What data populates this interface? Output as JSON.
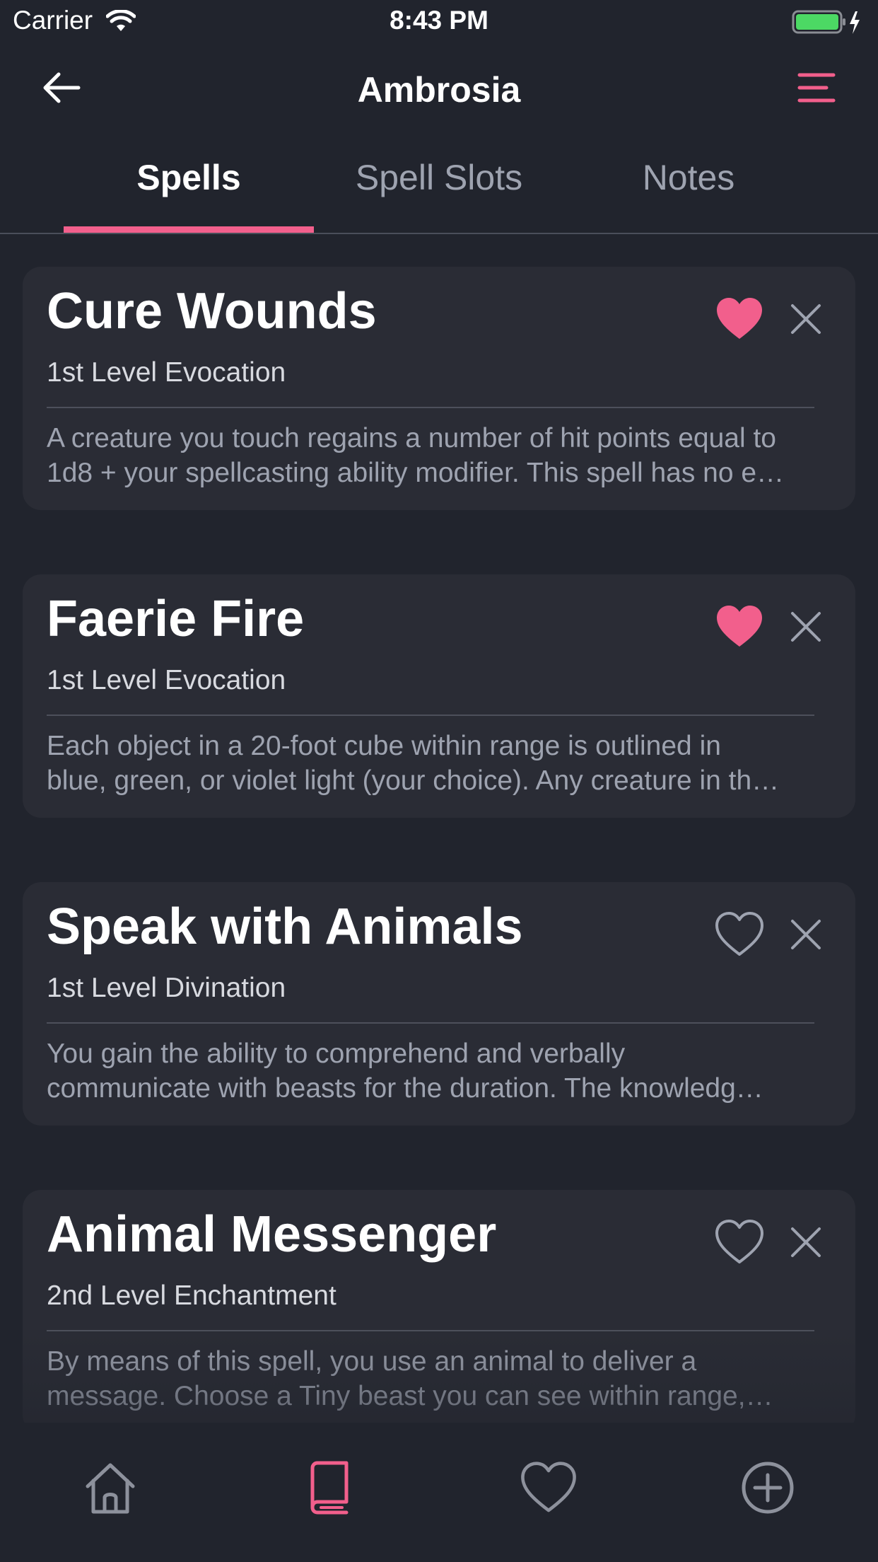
{
  "status_bar": {
    "carrier": "Carrier",
    "time": "8:43 PM",
    "wifi_icon": "wifi-icon",
    "battery_icon": "battery-charging-icon"
  },
  "nav": {
    "title": "Ambrosia",
    "back_icon": "arrow-left-icon",
    "menu_icon": "menu-icon"
  },
  "tabs": [
    {
      "label": "Spells",
      "active": true
    },
    {
      "label": "Spell Slots",
      "active": false
    },
    {
      "label": "Notes",
      "active": false
    }
  ],
  "spells": [
    {
      "name": "Cure Wounds",
      "level_school": "1st Level Evocation",
      "description_lines": [
        "A creature you touch regains a number of hit points equal to",
        "1d8 + your spellcasting ability modifier. This spell has no e…"
      ],
      "favorited": true
    },
    {
      "name": "Faerie Fire",
      "level_school": "1st Level Evocation",
      "description_lines": [
        "Each object in a 20-foot cube within range is outlined in",
        "blue, green, or violet light (your choice). Any creature in th…"
      ],
      "favorited": true
    },
    {
      "name": "Speak with Animals",
      "level_school": "1st Level Divination",
      "description_lines": [
        "You gain the ability to comprehend and verbally",
        "communicate with beasts for the duration. The knowledg…"
      ],
      "favorited": false
    },
    {
      "name": "Animal Messenger",
      "level_school": "2nd Level Enchantment",
      "description_lines": [
        "By means of this spell, you use an animal to deliver a",
        "message. Choose a Tiny beast you can see within range,…"
      ],
      "favorited": false
    }
  ],
  "tab_bar": {
    "items": [
      {
        "icon": "home-icon",
        "active": false
      },
      {
        "icon": "book-icon",
        "active": true
      },
      {
        "icon": "heart-icon",
        "active": false
      },
      {
        "icon": "add-circle-icon",
        "active": false
      }
    ]
  },
  "colors": {
    "background": "#21242d",
    "card": "#2a2c35",
    "accent": "#f25f8c",
    "muted": "#9ea3b0"
  }
}
